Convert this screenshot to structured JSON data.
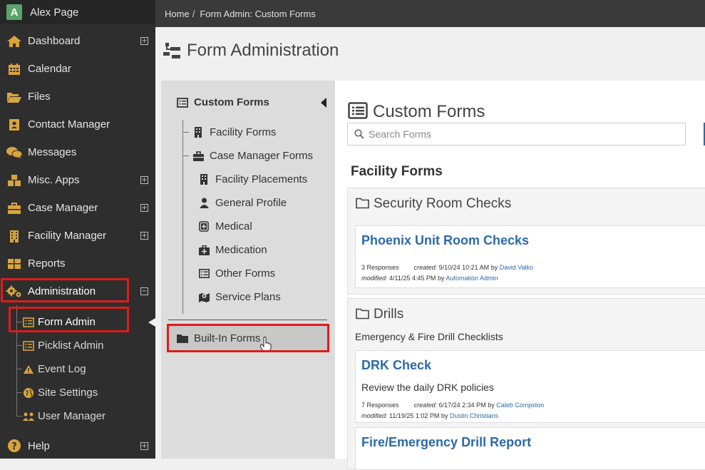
{
  "user": {
    "initial": "A",
    "name": "Alex Page"
  },
  "sidebar": {
    "items": [
      {
        "label": "Dashboard",
        "icon": "home-icon",
        "expander": "+"
      },
      {
        "label": "Calendar",
        "icon": "calendar-icon"
      },
      {
        "label": "Files",
        "icon": "folder-open-icon"
      },
      {
        "label": "Contact Manager",
        "icon": "contact-card-icon"
      },
      {
        "label": "Messages",
        "icon": "chat-bubbles-icon"
      },
      {
        "label": "Misc. Apps",
        "icon": "cubes-icon",
        "expander": "+"
      },
      {
        "label": "Case Manager",
        "icon": "briefcase-icon",
        "expander": "+"
      },
      {
        "label": "Facility Manager",
        "icon": "building-icon",
        "expander": "+"
      },
      {
        "label": "Reports",
        "icon": "table-icon"
      },
      {
        "label": "Administration",
        "icon": "gears-icon",
        "expander": "−"
      }
    ],
    "admin_subitems": [
      {
        "label": "Form Admin",
        "icon": "form-icon"
      },
      {
        "label": "Picklist Admin",
        "icon": "list-icon"
      },
      {
        "label": "Event Log",
        "icon": "warning-icon"
      },
      {
        "label": "Site Settings",
        "icon": "globe-icon"
      },
      {
        "label": "User Manager",
        "icon": "users-icon"
      }
    ],
    "help": {
      "label": "Help",
      "icon": "question-icon",
      "expander": "+"
    }
  },
  "breadcrumb": {
    "home": "Home",
    "separator": "/",
    "current": "Form Admin: Custom Forms"
  },
  "page_title": "Form Administration",
  "form_nav": {
    "root": "Custom Forms",
    "items": [
      {
        "label": "Facility Forms",
        "icon": "building-icon"
      },
      {
        "label": "Case Manager Forms",
        "icon": "briefcase-icon"
      }
    ],
    "case_children": [
      {
        "label": "Facility Placements",
        "icon": "building-icon"
      },
      {
        "label": "General Profile",
        "icon": "person-icon"
      },
      {
        "label": "Medical",
        "icon": "medical-plus-icon"
      },
      {
        "label": "Medication",
        "icon": "medkit-icon"
      },
      {
        "label": "Other Forms",
        "icon": "list-icon"
      },
      {
        "label": "Service Plans",
        "icon": "map-marker-icon"
      }
    ],
    "built_in": "Built-In Forms"
  },
  "main": {
    "title": "Custom Forms",
    "search_placeholder": "Search Forms",
    "section_title": "Facility Forms",
    "groups": [
      {
        "name": "Security Room Checks",
        "forms": [
          {
            "title": "Phoenix Unit Room Checks",
            "responses": "3 Responses",
            "created_label": "created:",
            "created": "9/10/24 10:21 AM",
            "by": "by",
            "created_by": "David Valko",
            "modified_label": "modified:",
            "modified": "4/11/25 4:45 PM",
            "modified_by": "Automation Admin"
          }
        ]
      },
      {
        "name": "Drills",
        "description": "Emergency & Fire Drill Checklists",
        "forms": [
          {
            "title": "DRK Check",
            "description": "Review the daily DRK policies",
            "responses": "7 Responses",
            "created_label": "created:",
            "created": "6/17/24 2:34 PM",
            "by": "by",
            "created_by": "Caleb Compston",
            "modified_label": "modified:",
            "modified": "11/19/25 1:02 PM",
            "modified_by": "Dustin Christians"
          },
          {
            "title": "Fire/Emergency Drill Report"
          }
        ]
      }
    ]
  },
  "colors": {
    "sidebar": "#2e2e2e",
    "highlight": "#e11a1a",
    "link": "#2c6aa8",
    "avatar": "#5aa469"
  }
}
